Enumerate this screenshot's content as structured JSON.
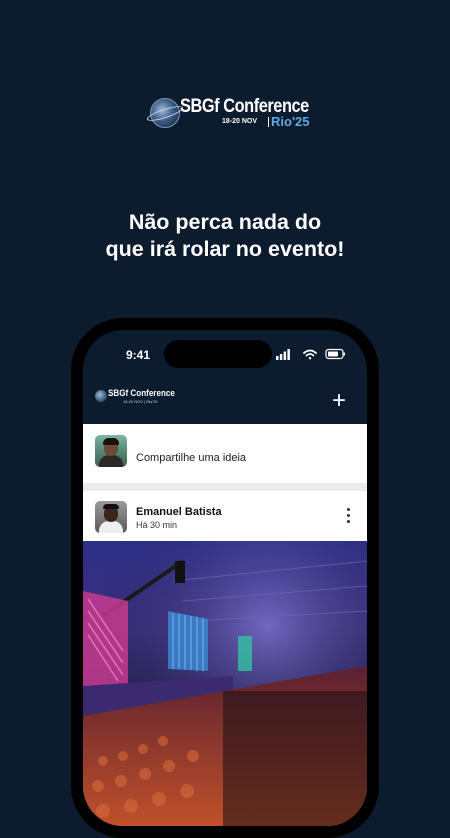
{
  "hero": {
    "logo_title": "SBGf Conference",
    "logo_dates": "18-20 NOV",
    "logo_place": "Rio'25",
    "headline_line1": "Não perca nada do",
    "headline_line2": "que irá rolar no evento!"
  },
  "phone": {
    "status_time": "9:41",
    "app_header": {
      "logo_title": "SBGf Conference",
      "logo_sub": "18-20 NOV | Rio'25",
      "add_label": "+"
    },
    "composer": {
      "placeholder": "Compartilhe uma ideia"
    },
    "post": {
      "author": "Emanuel Batista",
      "time": "Há 30 min"
    }
  },
  "colors": {
    "background": "#0d1b2e",
    "accent_blue": "#5fa8e6",
    "card": "#ffffff"
  }
}
